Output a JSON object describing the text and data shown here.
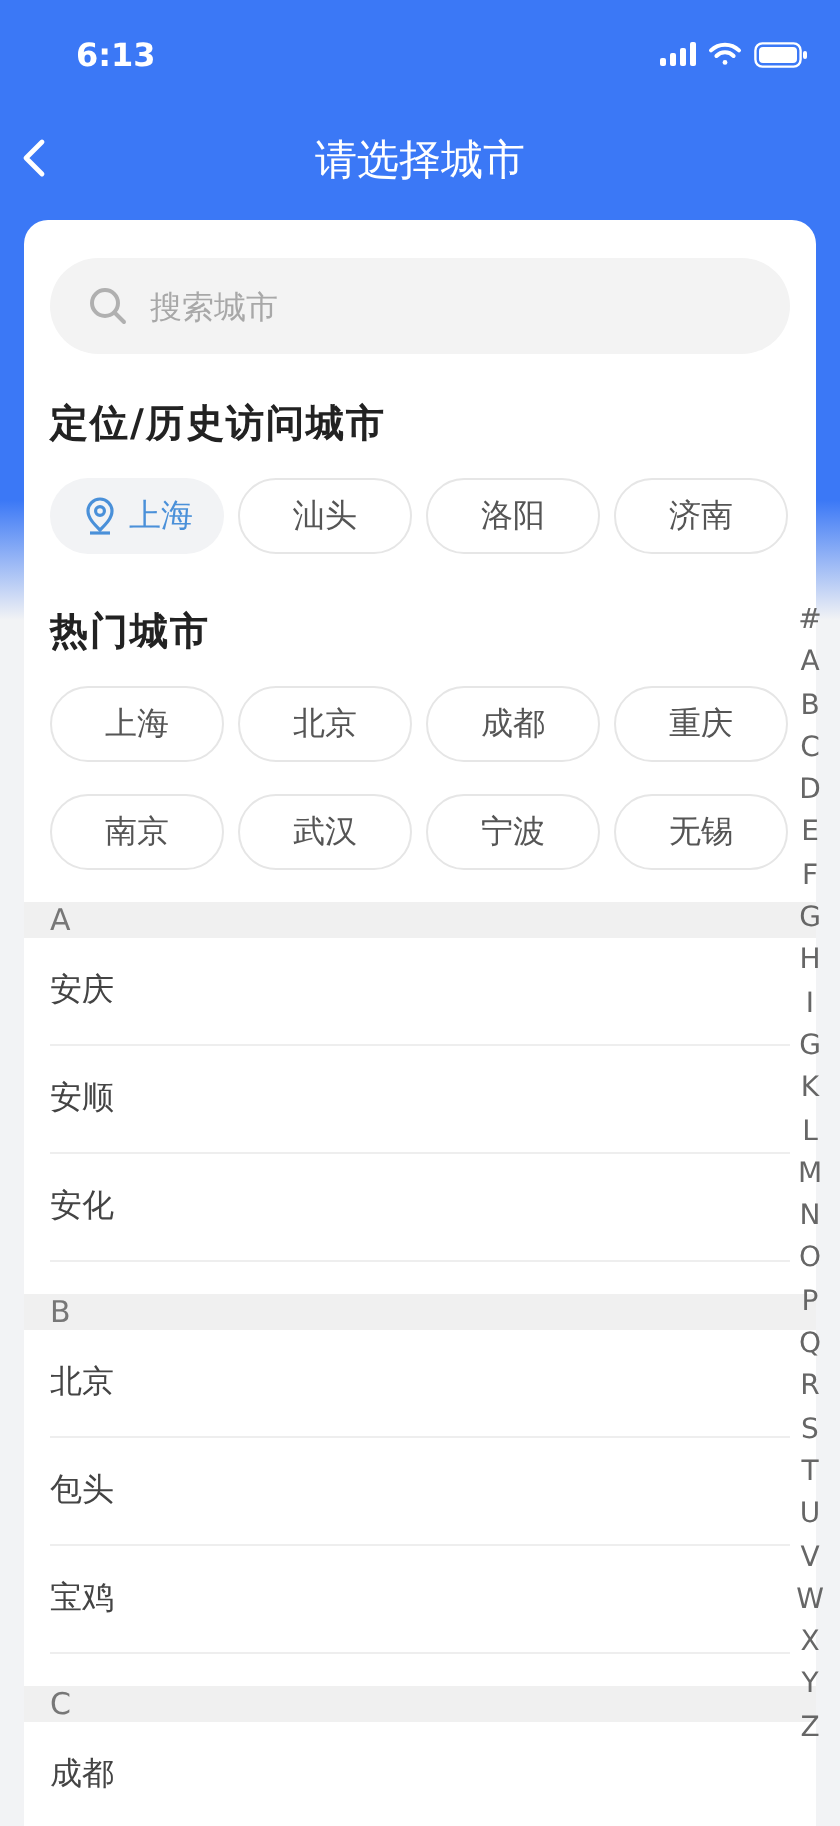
{
  "status_bar": {
    "time": "6:13"
  },
  "nav": {
    "title": "请选择城市"
  },
  "search": {
    "placeholder": "搜索城市"
  },
  "recent": {
    "heading": "定位/历史访问城市",
    "cities": [
      {
        "name": "上海",
        "kind": "location"
      },
      {
        "name": "汕头",
        "kind": "history"
      },
      {
        "name": "洛阳",
        "kind": "history"
      },
      {
        "name": "济南",
        "kind": "history"
      }
    ]
  },
  "hot": {
    "heading": "热门城市",
    "cities": [
      "上海",
      "北京",
      "成都",
      "重庆",
      "南京",
      "武汉",
      "宁波",
      "无锡"
    ]
  },
  "groups": [
    {
      "letter": "A",
      "cities": [
        "安庆",
        "安顺",
        "安化"
      ]
    },
    {
      "letter": "B",
      "cities": [
        "北京",
        "包头",
        "宝鸡"
      ]
    },
    {
      "letter": "C",
      "cities": [
        "成都"
      ]
    }
  ],
  "index": [
    "#",
    "A",
    "B",
    "C",
    "D",
    "E",
    "F",
    "G",
    "H",
    "I",
    "G",
    "K",
    "L",
    "M",
    "N",
    "O",
    "P",
    "Q",
    "R",
    "S",
    "T",
    "U",
    "V",
    "W",
    "X",
    "Y",
    "Z"
  ]
}
